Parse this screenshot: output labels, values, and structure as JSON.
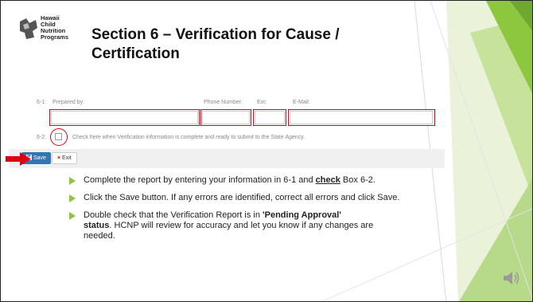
{
  "logo": {
    "lines": [
      "Hawaii",
      "Child",
      "Nutrition",
      "Programs"
    ]
  },
  "title": {
    "line1": "Section 6 – Verification for Cause /",
    "line2": "Certification"
  },
  "form": {
    "row_number": "6-1:",
    "prepared_by_label": "Prepared by:",
    "phone_label": "Phone Number:",
    "ext_label": "Ext:",
    "email_label": "E-Mail:",
    "check_row_number": "6-2:",
    "check_text": "Check here when Verification information is complete and ready to submit to the State Agency."
  },
  "toolbar": {
    "save_label": "Save",
    "exit_label": "Exit"
  },
  "bullets": {
    "b1_pre": "Complete the report by entering your information in 6-1 and ",
    "b1_bold": "check",
    "b1_post": " Box 6-2.",
    "b2": "Click the Save button.  If any errors are identified, correct all errors and click Save.",
    "b3_pre": "Double check that the Verification Report is in ",
    "b3_bold1": "'Pending Approval'",
    "b3_bold2": "status",
    "b3_post": ".  HCNP will review for accuracy and let you know if any changes are needed."
  },
  "colors": {
    "accent_green": "#8dc63f",
    "light_green": "#c6e29b",
    "highlight_red": "#e0000f",
    "save_blue": "#3276b1"
  },
  "icons": [
    "hawaii-logo-icon",
    "floppy-disk-icon",
    "red-arrow-icon",
    "speaker-icon"
  ]
}
